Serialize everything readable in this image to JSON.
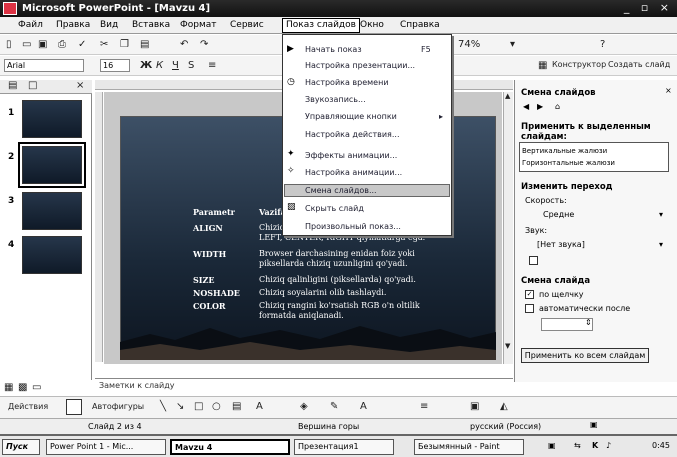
{
  "window": {
    "title": "Microsoft PowerPoint - [Mavzu 4]",
    "controls": "_ ▫ ×"
  },
  "menubar": {
    "items": [
      "Файл",
      "Правка",
      "Вид",
      "Вставка",
      "Формат",
      "Сервис",
      "Показ слайдов",
      "Окно",
      "Справка"
    ]
  },
  "toolbar1": {
    "zoom": "74%"
  },
  "toolbar2": {
    "font": "Arial",
    "size": "16",
    "designer": "Конструктор",
    "new_slide": "Создать слайд"
  },
  "dropdown": {
    "items": [
      {
        "label": "Начать показ",
        "shortcut": "F5"
      },
      {
        "label": "Настройка презентации..."
      },
      {
        "label": "Настройка времени"
      },
      {
        "label": "Звукозапись..."
      },
      {
        "label": "Управляющие кнопки"
      },
      {
        "label": "Настройка действия..."
      },
      {
        "label": "Эффекты анимации..."
      },
      {
        "label": "Настройка анимации..."
      },
      {
        "label": "Смена слайдов..."
      },
      {
        "label": "Скрыть слайд"
      },
      {
        "label": "Произвольный показ..."
      }
    ],
    "highlighted_index": 8
  },
  "slide": {
    "header_left": "Parametr",
    "header_right": "Vazifa",
    "rows": [
      {
        "param": "ALIGN",
        "desc_line1": "Chiziq joyla...",
        "desc_line2": "LEFT, CENTER, RIGHT qiymatlarga ega."
      },
      {
        "param": "WIDTH",
        "desc_line1": "Browser darchasining enidan foiz yoki",
        "desc_line2": "piksellarda chiziq uzunligini qo'yadi."
      },
      {
        "param": "SIZE",
        "desc_line1": "Chiziq qalinligini (piksellarda) qo'yadi.",
        "desc_line2": ""
      },
      {
        "param": "NOSHADE",
        "desc_line1": "Chiziq soyalarini olib tashlaydi.",
        "desc_line2": ""
      },
      {
        "param": "COLOR",
        "desc_line1": "Chiziq rangini ko'rsatish RGB o'n oltilik",
        "desc_line2": "formatda aniqlanadi."
      }
    ]
  },
  "slides_pane": {
    "numbers": [
      "1",
      "2",
      "3",
      "4"
    ]
  },
  "taskpane": {
    "title": "Смена слайдов",
    "apply_label": "Применить к выделенным слайдам:",
    "list_rows": [
      "Вертикальные жалюзи",
      "Горизонтальные жалюзи"
    ],
    "modify_label": "Изменить переход",
    "speed_label": "Скорость:",
    "speed_value": "Средне",
    "sound_label": "Звук:",
    "sound_value": "[Нет звука]",
    "advance_label": "Смена слайда",
    "on_click": "по щелчку",
    "auto_after": "автоматически после",
    "apply_all": "Применить ко всем слайдам"
  },
  "notes": {
    "placeholder": "Заметки к слайду"
  },
  "drawbar": {
    "actions": "Действия",
    "autoshapes": "Автофигуры"
  },
  "status": {
    "slide": "Слайд 2 из 4",
    "design": "Вершина горы",
    "language": "русский (Россия)"
  },
  "taskbar": {
    "start": "Пуск",
    "buttons": [
      "Power Point 1 - Mic...",
      "Mavzu 4",
      "Презентация1",
      "Безымянный - Paint"
    ],
    "time": "0:45"
  }
}
